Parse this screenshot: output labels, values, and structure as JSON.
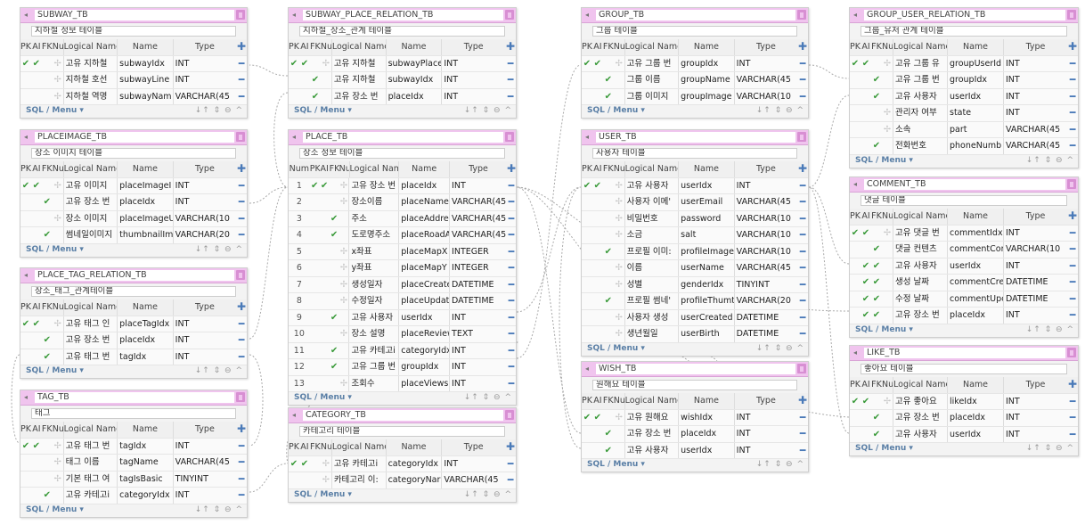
{
  "footer": {
    "sql_menu": "SQL / Menu ▾",
    "controls": "↓↑ ⇕ ⊖ ^"
  },
  "col_headers": {
    "pk": "PK",
    "ai": "AI",
    "fk": "FK",
    "null": "Null",
    "logical": "Logical Name",
    "name": "Name",
    "type": "Type",
    "num": "Num"
  },
  "tables": {
    "subway": {
      "title": "SUBWAY_TB",
      "comment": "지하철 정보 테이블",
      "rows": [
        {
          "pk": "✔",
          "ai": "✔",
          "fk": "",
          "logical": "고유 지하철",
          "name": "subwayIdx",
          "type": "INT"
        },
        {
          "pk": "",
          "ai": "",
          "fk": "",
          "logical": "지하철 호선",
          "name": "subwayLine",
          "type": "INT"
        },
        {
          "pk": "",
          "ai": "",
          "fk": "",
          "logical": "지하철 역명",
          "name": "subwayNam",
          "type": "VARCHAR(45"
        }
      ]
    },
    "placeimage": {
      "title": "PLACEIMAGE_TB",
      "comment": "장소 이미지 테이블",
      "rows": [
        {
          "pk": "✔",
          "ai": "✔",
          "fk": "",
          "logical": "고유 이미지",
          "name": "placeImageI",
          "type": "INT"
        },
        {
          "pk": "",
          "ai": "",
          "fk": "✔",
          "logical": "고유 장소 번",
          "name": "placeIdx",
          "type": "INT"
        },
        {
          "pk": "",
          "ai": "",
          "fk": "",
          "logical": "장소 이미지",
          "name": "placeImageU",
          "type": "VARCHAR(10"
        },
        {
          "pk": "",
          "ai": "",
          "fk": "✔",
          "logical": "썸네일이미지",
          "name": "thumbnailIm",
          "type": "VARCHAR(20"
        }
      ]
    },
    "place_tag": {
      "title": "PLACE_TAG_RELATION_TB",
      "comment": "장소_태그_관계테이블",
      "rows": [
        {
          "pk": "✔",
          "ai": "✔",
          "fk": "",
          "logical": "고유 태그 인",
          "name": "placeTagIdx",
          "type": "INT"
        },
        {
          "pk": "",
          "ai": "",
          "fk": "✔",
          "logical": "고유 장소 번",
          "name": "placeIdx",
          "type": "INT"
        },
        {
          "pk": "",
          "ai": "",
          "fk": "✔",
          "logical": "고유 태그 번",
          "name": "tagIdx",
          "type": "INT"
        }
      ]
    },
    "tag": {
      "title": "TAG_TB",
      "comment": "태그",
      "rows": [
        {
          "pk": "✔",
          "ai": "✔",
          "fk": "",
          "logical": "고유 태그 번",
          "name": "tagIdx",
          "type": "INT"
        },
        {
          "pk": "",
          "ai": "",
          "fk": "",
          "logical": "태그 이름",
          "name": "tagName",
          "type": "VARCHAR(45"
        },
        {
          "pk": "",
          "ai": "",
          "fk": "",
          "logical": "기본 태그 여",
          "name": "tagIsBasic",
          "type": "TINYINT"
        },
        {
          "pk": "",
          "ai": "",
          "fk": "✔",
          "logical": "고유 카테고i",
          "name": "categoryIdx",
          "type": "INT"
        }
      ]
    },
    "subway_place": {
      "title": "SUBWAY_PLACE_RELATION_TB",
      "comment": "지하철_장소_관계 테이블",
      "rows": [
        {
          "pk": "✔",
          "ai": "✔",
          "fk": "",
          "logical": "고유 지하철",
          "name": "subwayPlace",
          "type": "INT"
        },
        {
          "pk": "",
          "ai": "",
          "fk": "✔",
          "logical": "고유 지하철",
          "name": "subwayIdx",
          "type": "INT"
        },
        {
          "pk": "",
          "ai": "",
          "fk": "✔",
          "logical": "고유 장소 번",
          "name": "placeIdx",
          "type": "INT"
        }
      ]
    },
    "place": {
      "title": "PLACE_TB",
      "comment": "장소 정보 테이블",
      "rows": [
        {
          "num": "1",
          "pk": "✔",
          "ai": "✔",
          "fk": "",
          "logical": "고유 장소 번",
          "name": "placeIdx",
          "type": "INT"
        },
        {
          "num": "2",
          "pk": "",
          "ai": "",
          "fk": "",
          "logical": "장소이름",
          "name": "placeName",
          "type": "VARCHAR(45"
        },
        {
          "num": "3",
          "pk": "",
          "ai": "",
          "fk": "✔",
          "logical": "주소",
          "name": "placeAddres",
          "type": "VARCHAR(45"
        },
        {
          "num": "4",
          "pk": "",
          "ai": "",
          "fk": "✔",
          "logical": "도로명주소",
          "name": "placeRoadA",
          "type": "VARCHAR(45"
        },
        {
          "num": "5",
          "pk": "",
          "ai": "",
          "fk": "",
          "logical": "x좌표",
          "name": "placeMapX",
          "type": "INTEGER"
        },
        {
          "num": "6",
          "pk": "",
          "ai": "",
          "fk": "",
          "logical": "y좌표",
          "name": "placeMapY",
          "type": "INTEGER"
        },
        {
          "num": "7",
          "pk": "",
          "ai": "",
          "fk": "",
          "logical": "생성일자",
          "name": "placeCreate",
          "type": "DATETIME"
        },
        {
          "num": "8",
          "pk": "",
          "ai": "",
          "fk": "",
          "logical": "수정일자",
          "name": "placeUpdate",
          "type": "DATETIME"
        },
        {
          "num": "9",
          "pk": "",
          "ai": "",
          "fk": "✔",
          "logical": "고유 사용자",
          "name": "userIdx",
          "type": "INT"
        },
        {
          "num": "10",
          "pk": "",
          "ai": "",
          "fk": "",
          "logical": "장소 설명",
          "name": "placeReview",
          "type": "TEXT"
        },
        {
          "num": "11",
          "pk": "",
          "ai": "",
          "fk": "✔",
          "logical": "고유 카테고i",
          "name": "categoryIdx",
          "type": "INT"
        },
        {
          "num": "12",
          "pk": "",
          "ai": "",
          "fk": "✔",
          "logical": "고유 그룹 번",
          "name": "groupIdx",
          "type": "INT"
        },
        {
          "num": "13",
          "pk": "",
          "ai": "",
          "fk": "",
          "logical": "조회수",
          "name": "placeViews",
          "type": "INT"
        }
      ]
    },
    "category": {
      "title": "CATEGORY_TB",
      "comment": "카테고리 테이블",
      "rows": [
        {
          "pk": "✔",
          "ai": "✔",
          "fk": "",
          "logical": "고유 카테고i",
          "name": "categoryIdx",
          "type": "INT"
        },
        {
          "pk": "",
          "ai": "",
          "fk": "",
          "logical": "카테고리 이:",
          "name": "categoryNar",
          "type": "VARCHAR(45"
        }
      ]
    },
    "group": {
      "title": "GROUP_TB",
      "comment": "그룹 테이블",
      "rows": [
        {
          "pk": "✔",
          "ai": "✔",
          "fk": "",
          "logical": "고유 그룹 번",
          "name": "groupIdx",
          "type": "INT"
        },
        {
          "pk": "",
          "ai": "",
          "fk": "✔",
          "logical": "그룹 이름",
          "name": "groupName",
          "type": "VARCHAR(45"
        },
        {
          "pk": "",
          "ai": "",
          "fk": "✔",
          "logical": "그룹 이미지",
          "name": "groupImage",
          "type": "VARCHAR(10"
        }
      ]
    },
    "user": {
      "title": "USER_TB",
      "comment": "사용자 테이블",
      "rows": [
        {
          "pk": "✔",
          "ai": "✔",
          "fk": "",
          "logical": "고유 사용자",
          "name": "userIdx",
          "type": "INT"
        },
        {
          "pk": "",
          "ai": "",
          "fk": "",
          "logical": "사용자 이메'",
          "name": "userEmail",
          "type": "VARCHAR(45"
        },
        {
          "pk": "",
          "ai": "",
          "fk": "",
          "logical": "비밀번호",
          "name": "password",
          "type": "VARCHAR(10"
        },
        {
          "pk": "",
          "ai": "",
          "fk": "",
          "logical": "소금",
          "name": "salt",
          "type": "VARCHAR(10"
        },
        {
          "pk": "",
          "ai": "",
          "fk": "✔",
          "logical": "프로필 이미:",
          "name": "profileImage",
          "type": "VARCHAR(10"
        },
        {
          "pk": "",
          "ai": "",
          "fk": "",
          "logical": "이름",
          "name": "userName",
          "type": "VARCHAR(45"
        },
        {
          "pk": "",
          "ai": "",
          "fk": "",
          "logical": "성별",
          "name": "genderIdx",
          "type": "TINYINT"
        },
        {
          "pk": "",
          "ai": "",
          "fk": "✔",
          "logical": "프로필 썸네'",
          "name": "profileThumt",
          "type": "VARCHAR(20"
        },
        {
          "pk": "",
          "ai": "",
          "fk": "",
          "logical": "사용자 생성",
          "name": "userCreated",
          "type": "DATETIME"
        },
        {
          "pk": "",
          "ai": "",
          "fk": "",
          "logical": "생년월일",
          "name": "userBirth",
          "type": "DATETIME"
        }
      ]
    },
    "wish": {
      "title": "WISH_TB",
      "comment": "원해요 테이블",
      "rows": [
        {
          "pk": "✔",
          "ai": "✔",
          "fk": "",
          "logical": "고유 원해요",
          "name": "wishIdx",
          "type": "INT"
        },
        {
          "pk": "",
          "ai": "",
          "fk": "✔",
          "logical": "고유 장소 번",
          "name": "placeIdx",
          "type": "INT"
        },
        {
          "pk": "",
          "ai": "",
          "fk": "✔",
          "logical": "고유 사용자",
          "name": "userIdx",
          "type": "INT"
        }
      ]
    },
    "group_user": {
      "title": "GROUP_USER_RELATION_TB",
      "comment": "그룹_유저 관계 테이블",
      "rows": [
        {
          "pk": "✔",
          "ai": "✔",
          "fk": "",
          "logical": "고유 그룹 유",
          "name": "groupUserId",
          "type": "INT"
        },
        {
          "pk": "",
          "ai": "",
          "fk": "✔",
          "logical": "고유 그룹 번",
          "name": "groupIdx",
          "type": "INT"
        },
        {
          "pk": "",
          "ai": "",
          "fk": "✔",
          "logical": "고유 사용자",
          "name": "userIdx",
          "type": "INT"
        },
        {
          "pk": "",
          "ai": "",
          "fk": "",
          "logical": "관리자 여부",
          "name": "state",
          "type": "INT"
        },
        {
          "pk": "",
          "ai": "",
          "fk": "",
          "logical": "소속",
          "name": "part",
          "type": "VARCHAR(45"
        },
        {
          "pk": "",
          "ai": "",
          "fk": "✔",
          "logical": "전화번호",
          "name": "phoneNumb",
          "type": "VARCHAR(45"
        }
      ]
    },
    "comment": {
      "title": "COMMENT_TB",
      "comment": "댓글 테이블",
      "rows": [
        {
          "pk": "✔",
          "ai": "✔",
          "fk": "",
          "logical": "고유 댓글 번",
          "name": "commentIdx",
          "type": "INT"
        },
        {
          "pk": "",
          "ai": "",
          "fk": "✔",
          "logical": "댓글 컨텐츠",
          "name": "commentCor",
          "type": "VARCHAR(10"
        },
        {
          "pk": "",
          "ai": "✔",
          "fk": "✔",
          "logical": "고유 사용자",
          "name": "userIdx",
          "type": "INT"
        },
        {
          "pk": "",
          "ai": "✔",
          "fk": "✔",
          "logical": "생성 날짜",
          "name": "commentCre",
          "type": "DATETIME"
        },
        {
          "pk": "",
          "ai": "✔",
          "fk": "✔",
          "logical": "수정 날짜",
          "name": "commentUpc",
          "type": "DATETIME"
        },
        {
          "pk": "",
          "ai": "✔",
          "fk": "✔",
          "logical": "고유 장소 번",
          "name": "placeIdx",
          "type": "INT"
        }
      ]
    },
    "like": {
      "title": "LIKE_TB",
      "comment": "좋아요 테이블",
      "rows": [
        {
          "pk": "✔",
          "ai": "✔",
          "fk": "",
          "logical": "고유 좋아요",
          "name": "likeIdx",
          "type": "INT"
        },
        {
          "pk": "",
          "ai": "",
          "fk": "✔",
          "logical": "고유 장소 번",
          "name": "placeIdx",
          "type": "INT"
        },
        {
          "pk": "",
          "ai": "",
          "fk": "✔",
          "logical": "고유 사용자",
          "name": "userIdx",
          "type": "INT"
        }
      ]
    }
  }
}
